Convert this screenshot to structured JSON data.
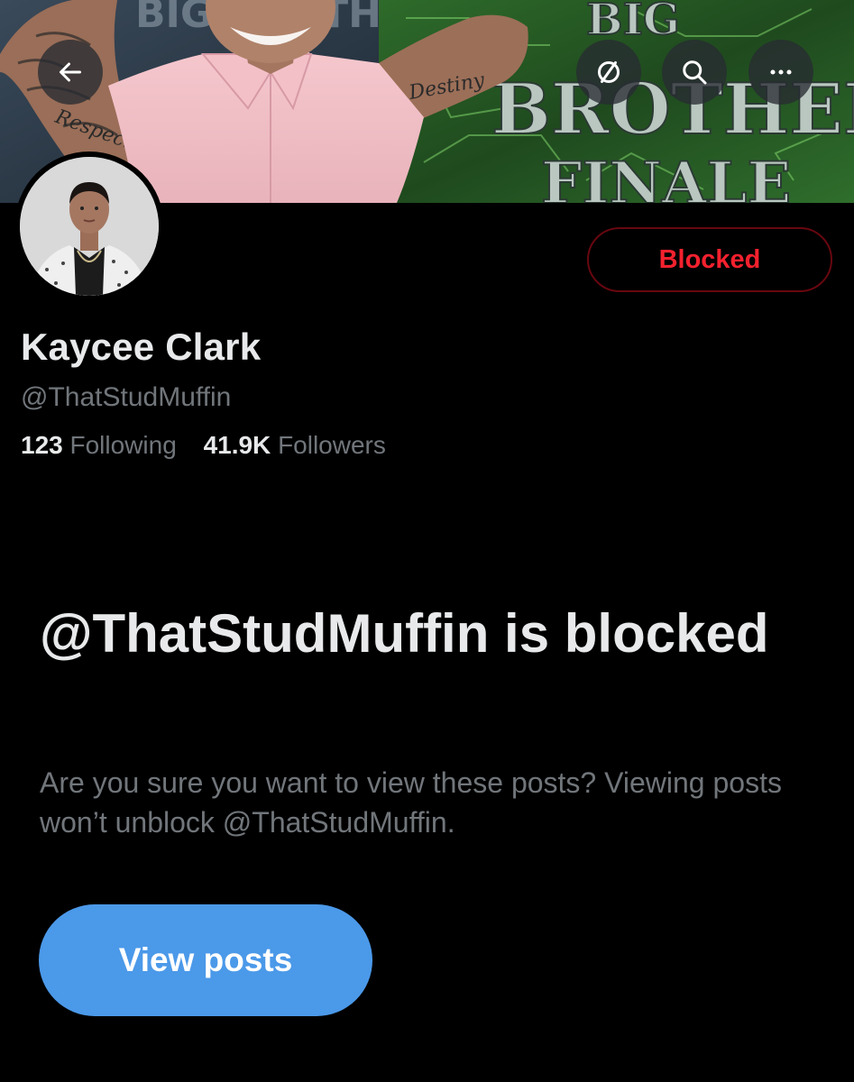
{
  "header": {
    "back_icon": "arrow-left-icon",
    "translate_icon": "translate-icon",
    "search_icon": "search-icon",
    "more_icon": "more-horizontal-icon",
    "banner_text_left": "BIG BROTH",
    "banner_text_right": [
      "BIG",
      "BROTHER",
      "FINALE"
    ],
    "tattoo_text": [
      "Respect",
      "Destiny"
    ]
  },
  "profile": {
    "display_name": "Kaycee Clark",
    "handle": "@ThatStudMuffin",
    "following_count": "123",
    "following_label": "Following",
    "followers_count": "41.9K",
    "followers_label": "Followers",
    "blocked_label": "Blocked"
  },
  "blocked_notice": {
    "title": "@ThatStudMuffin is blocked",
    "description": "Are you sure you want to view these posts? Viewing posts won’t unblock @ThatStudMuffin.",
    "view_posts_label": "View posts"
  },
  "colors": {
    "background": "#000000",
    "text_primary": "#e7e9ea",
    "text_secondary": "#71767b",
    "blocked_red": "#f4212e",
    "blocked_border": "#67070f",
    "button_blue": "#4b99e9"
  }
}
